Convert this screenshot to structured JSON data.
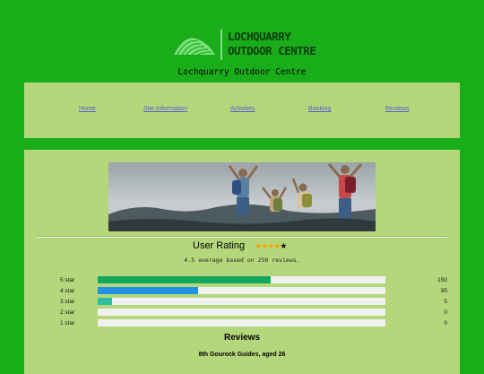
{
  "header": {
    "logo_line1": "LOCHQUARRY",
    "logo_line2": "OUTDOOR CENTRE",
    "site_title": "Lochquarry Outdoor Centre",
    "colors": {
      "background": "#1aad1a",
      "panel": "#b5d77c",
      "logo_text": "#0d3d0d"
    }
  },
  "nav": {
    "items": [
      {
        "label": "Home"
      },
      {
        "label": "Site Information"
      },
      {
        "label": "Activities"
      },
      {
        "label": "Booking"
      },
      {
        "label": "Reviews"
      }
    ]
  },
  "hero": {
    "icon": "hiking-group-photo"
  },
  "rating": {
    "title": "User Rating",
    "stars_filled": 4,
    "stars_total": 5,
    "summary": "4.5 average based on 250 reviews.",
    "bars": [
      {
        "label": "5 star",
        "count": "150",
        "fraction": 0.6,
        "color": "#14a85c"
      },
      {
        "label": "4 star",
        "count": "95",
        "fraction": 0.35,
        "color": "#2392e6"
      },
      {
        "label": "3 star",
        "count": "5",
        "fraction": 0.05,
        "color": "#2fbfa0"
      },
      {
        "label": "2 star",
        "count": "0",
        "fraction": 0,
        "color": "#f5a300"
      },
      {
        "label": "1 star",
        "count": "0",
        "fraction": 0,
        "color": "#e53935"
      }
    ]
  },
  "reviews": {
    "title": "Reviews",
    "first_author": "8th Gourock Guides, aged 26"
  }
}
